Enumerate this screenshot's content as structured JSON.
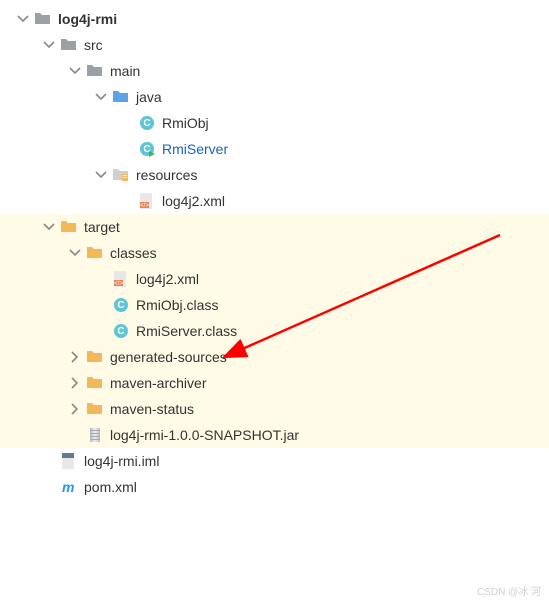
{
  "tree": {
    "root": {
      "label": "log4j-rmi"
    },
    "src": {
      "label": "src"
    },
    "main": {
      "label": "main"
    },
    "java": {
      "label": "java"
    },
    "rmiObj": {
      "label": "RmiObj"
    },
    "rmiServer": {
      "label": "RmiServer"
    },
    "resources": {
      "label": "resources"
    },
    "log4j2xml": {
      "label": "log4j2.xml"
    },
    "target": {
      "label": "target"
    },
    "classes": {
      "label": "classes"
    },
    "log4j2xml2": {
      "label": "log4j2.xml"
    },
    "rmiObjClass": {
      "label": "RmiObj.class"
    },
    "rmiServerClass": {
      "label": "RmiServer.class"
    },
    "generatedSources": {
      "label": "generated-sources"
    },
    "mavenArchiver": {
      "label": "maven-archiver"
    },
    "mavenStatus": {
      "label": "maven-status"
    },
    "jar": {
      "label": "log4j-rmi-1.0.0-SNAPSHOT.jar"
    },
    "iml": {
      "label": "log4j-rmi.iml"
    },
    "pom": {
      "label": "pom.xml"
    }
  },
  "colors": {
    "folderGray": "#9aa0a6",
    "folderBlue": "#5aa3e8",
    "folderOrange": "#f2b85a",
    "classIcon": "#5ec4d6",
    "xmlIcon": "#e8845a",
    "highlight": "#fffbe6",
    "selected": "#1565c0",
    "mavenBlue": "#2196f3"
  },
  "watermark": "CSDN @冰 河"
}
